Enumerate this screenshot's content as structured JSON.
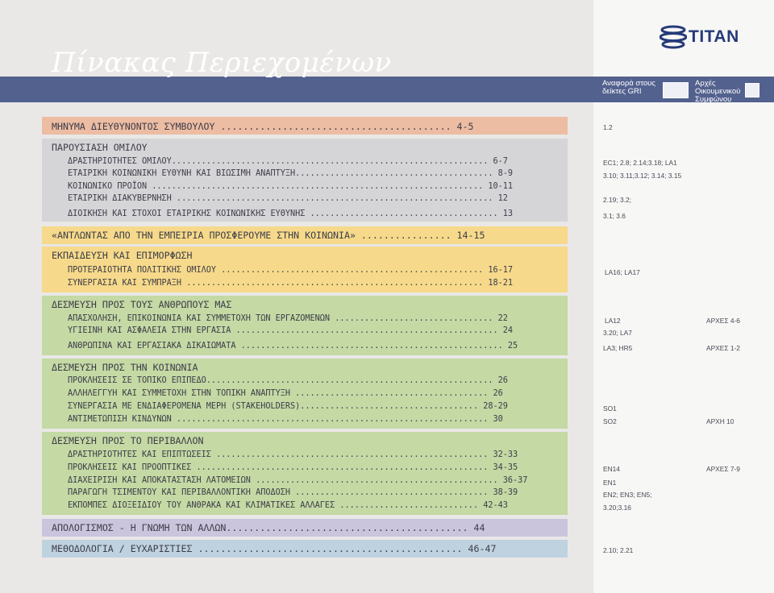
{
  "page_title": "Πίνακας Περιεχομένων",
  "brand": {
    "name": "TITAN"
  },
  "columns": {
    "gri": "Αναφορά στους δείκτες GRI",
    "gc": "Αρχές Οικουμενικού Συμφώνου"
  },
  "colors": {
    "title_band": "#53618f",
    "orange": "#ecbca3",
    "grey": "#d5d5d8",
    "yellow": "#f6d98a",
    "green": "#c4d9a4",
    "lavender": "#cac4dd",
    "blue": "#bed2df"
  },
  "toc": {
    "s1": {
      "line": "ΜΗΝΥΜΑ ΔΙΕΥΘΥΝΟΝΤΟΣ ΣΥΜΒΟΥΛΟΥ ......................................... 4-5"
    },
    "s2": {
      "title": "ΠΑΡΟΥΣΙΑΣΗ ΟΜΙΛΟΥ",
      "i1": "ΔΡΑΣΤΗΡΙΟΤΗΤΕΣ ΟΜΙΛΟΥ................................................................ 6-7",
      "i2": "ΕΤΑΙΡΙΚΗ ΚΟΙΝΩΝΙΚΗ ΕΥΘΥΝΗ ΚΑΙ ΒΙΩΣΙΜΗ ΑΝΑΠΤΥΞΗ........................................ 8-9",
      "i3": "ΚΟΙΝΩΝΙΚΟ ΠΡΟΪΟΝ ................................................................... 10-11",
      "i4": "ΕΤΑΙΡΙΚΗ ΔΙΑΚΥΒΕΡΝΗΣΗ ................................................................ 12",
      "i5": "ΔΙΟΙΚΗΣΗ ΚΑΙ ΣΤΟΧΟΙ ΕΤΑΙΡΙΚΗΣ ΚΟΙΝΩΝΙΚΗΣ ΕΥΘΥΝΗΣ ...................................... 13"
    },
    "s3": {
      "line": "«ΑΝΤΛΩΝΤΑΣ ΑΠΟ ΤΗΝ ΕΜΠΕΙΡΙΑ ΠΡΟΣΦΕΡΟΥΜΕ ΣΤΗΝ ΚΟΙΝΩΝΙΑ» ................ 14-15"
    },
    "s4": {
      "title": "ΕΚΠΑΙΔΕΥΣΗ ΚΑΙ ΕΠΙΜΟΡΦΩΣΗ",
      "i1": "ΠΡΟΤΕΡΑΙΟΤΗΤΑ ΠΟΛΙΤΙΚΗΣ ΟΜΙΛΟΥ ..................................................... 16-17",
      "i2": "ΣΥΝΕΡΓΑΣΙΑ ΚΑΙ ΣΥΜΠΡΑΞΗ ............................................................ 18-21"
    },
    "s5": {
      "title": "ΔΕΣΜΕΥΣΗ ΠΡΟΣ ΤΟΥΣ ΑΝΘΡΩΠΟΥΣ ΜΑΣ",
      "i1": "ΑΠΑΣΧΟΛΗΣΗ, ΕΠΙΚΟΙΝΩΝΙΑ ΚΑΙ ΣΥΜΜΕΤΟΧΗ ΤΩΝ ΕΡΓΑΖΟΜΕΝΩΝ ................................ 22",
      "i2": "ΥΓΙΕΙΝΗ ΚΑΙ ΑΣΦΑΛΕΙΑ ΣΤΗΝ ΕΡΓΑΣΙΑ ..................................................... 24",
      "i3": "ΑΝΘΡΩΠΙΝΑ ΚΑΙ ΕΡΓΑΣΙΑΚΑ ΔΙΚΑΙΩΜΑΤΑ ..................................................... 25"
    },
    "s6": {
      "title": "ΔΕΣΜΕΥΣΗ ΠΡΟΣ ΤΗΝ ΚΟΙΝΩΝΙΑ",
      "i1": "ΠΡΟΚΛΗΣΕΙΣ ΣΕ ΤΟΠΙΚΟ ΕΠΙΠΕΔΟ.......................................................... 26",
      "i2": "ΑΛΛΗΛΕΓΓΥΗ ΚΑΙ ΣΥΜΜΕΤΟΧΗ ΣΤΗΝ ΤΟΠΙΚΗ ΑΝΑΠΤΥΞΗ ....................................... 26",
      "i3": "ΣΥΝΕΡΓΑΣΙΑ ΜΕ ΕΝΔΙΑΦΕΡΟΜΕΝΑ ΜΕΡΗ (STAKEHOLDERS).................................... 28-29",
      "i4": "ΑΝΤΙΜΕΤΩΠΙΣΗ ΚΙΝΔΥΝΩΝ ............................................................... 30"
    },
    "s7": {
      "title": "ΔΕΣΜΕΥΣΗ ΠΡΟΣ ΤΟ ΠΕΡΙΒΑΛΛΟΝ",
      "i1": "ΔΡΑΣΤΗΡΙΟΤΗΤΕΣ ΚΑΙ ΕΠΙΠΤΩΣΕΙΣ ....................................................... 32-33",
      "i2": "ΠΡΟΚΛΗΣΕΙΣ ΚΑΙ ΠΡΟΟΠΤΙΚΕΣ ........................................................... 34-35",
      "i3": "ΔΙΑΧΕΙΡΙΣΗ ΚΑΙ ΑΠΟΚΑΤΑΣΤΑΣΗ ΛΑΤΟΜΕΙΩΝ ................................................. 36-37",
      "i4": "ΠΑΡΑΓΩΓΗ ΤΣΙΜΕΝΤΟΥ ΚΑΙ ΠΕΡΙΒΑΛΛΟΝΤΙΚΗ ΑΠΟΔΟΣΗ ....................................... 38-39",
      "i5": "ΕΚΠΟΜΠΕΣ ΔΙΟΞΕΙΔΙΟΥ ΤΟΥ ΑΝΘΡΑΚΑ ΚΑΙ ΚΛΙΜΑΤΙΚΕΣ ΑΛΛΑΓΕΣ ............................ 42-43"
    },
    "s8": {
      "line": "ΑΠΟΛΟΓΙΣΜΟΣ - Η ΓΝΩΜΗ ΤΩΝ ΑΛΛΩΝ........................................... 44"
    },
    "s9": {
      "line": "ΜΕΘΟΔΟΛΟΓΙΑ / ΕΥΧΑΡΙΣΤΙΕΣ ............................................... 46-47"
    }
  },
  "refs": {
    "r1": "1.2",
    "r2": "EC1; 2.8; 2.14;3.18; LA1",
    "r3": "3.10; 3.11;3.12; 3.14; 3.15",
    "r4": "2.19; 3.2;",
    "r5": "3.1; 3.6",
    "r6": "LA16; LA17",
    "r7": "LA12",
    "r7b": "ΑΡΧΕΣ 4-6",
    "r8": "3.20; LA7",
    "r9": "LA3; HR5",
    "r9b": "ΑΡΧΕΣ 1-2",
    "r10": "SO1",
    "r11": "SO2",
    "r11b": "ΑΡΧΗ 10",
    "r12": "EN14",
    "r12b": "ΑΡΧΕΣ 7-9",
    "r13": "EN1",
    "r14": "EN2; EN3; EN5;",
    "r15": "3.20;3.16",
    "r16": "2.10; 2.21"
  }
}
